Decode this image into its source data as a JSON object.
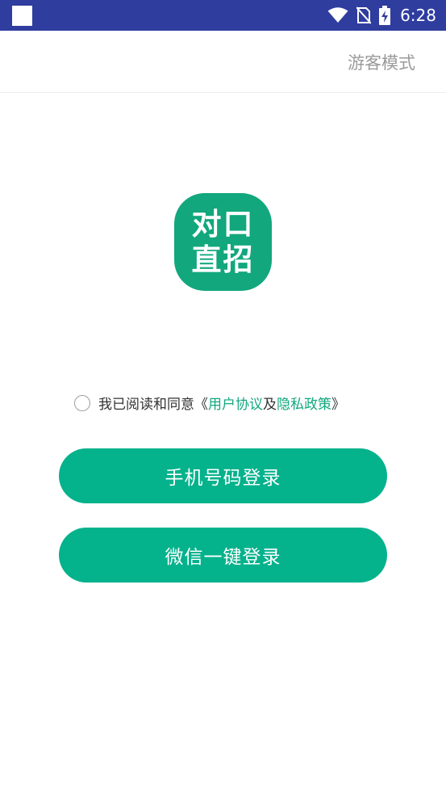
{
  "status_bar": {
    "time": "6:28",
    "icons": [
      "wifi-icon",
      "no-sim-icon",
      "battery-charging-icon"
    ]
  },
  "toolbar": {
    "guest_mode_label": "游客模式"
  },
  "logo": {
    "line1": "对口",
    "line2": "直招"
  },
  "agreement": {
    "prefix": "我已阅读和同意《",
    "user_agreement": "用户协议",
    "conjunction": "及",
    "privacy_policy": "隐私政策",
    "suffix": "》",
    "checked": false
  },
  "buttons": {
    "phone_login": "手机号码登录",
    "wechat_login": "微信一键登录"
  },
  "colors": {
    "status_bar": "#2f3d9f",
    "brand_green": "#04b28c",
    "logo_green": "#12a77d",
    "guest_text": "#9a9a9a"
  }
}
